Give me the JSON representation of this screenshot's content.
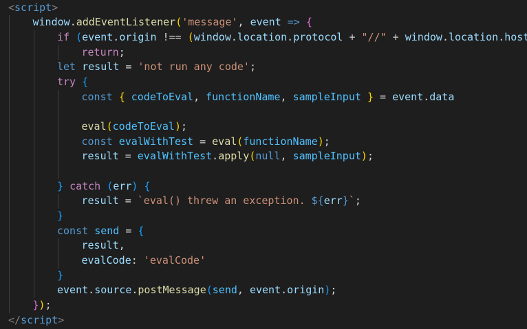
{
  "lines": [
    {
      "indent": 0,
      "tokens": [
        {
          "t": "<",
          "c": "t-tag"
        },
        {
          "t": "script",
          "c": "t-tagname"
        },
        {
          "t": ">",
          "c": "t-tag"
        }
      ]
    },
    {
      "indent": 1,
      "tokens": [
        {
          "t": "window",
          "c": "t-var"
        },
        {
          "t": ".",
          "c": "t-punc"
        },
        {
          "t": "addEventListener",
          "c": "t-fn"
        },
        {
          "t": "(",
          "c": "t-paren"
        },
        {
          "t": "'message'",
          "c": "t-string"
        },
        {
          "t": ", ",
          "c": "t-punc"
        },
        {
          "t": "event",
          "c": "t-var"
        },
        {
          "t": " ",
          "c": "t-punc"
        },
        {
          "t": "=>",
          "c": "t-keyword"
        },
        {
          "t": " ",
          "c": "t-punc"
        },
        {
          "t": "{",
          "c": "t-paren2"
        }
      ]
    },
    {
      "indent": 2,
      "tokens": [
        {
          "t": "if",
          "c": "t-control"
        },
        {
          "t": " ",
          "c": "t-punc"
        },
        {
          "t": "(",
          "c": "t-paren3"
        },
        {
          "t": "event",
          "c": "t-var"
        },
        {
          "t": ".",
          "c": "t-punc"
        },
        {
          "t": "origin",
          "c": "t-var"
        },
        {
          "t": " !== ",
          "c": "t-punc"
        },
        {
          "t": "(",
          "c": "t-paren"
        },
        {
          "t": "window",
          "c": "t-var"
        },
        {
          "t": ".",
          "c": "t-punc"
        },
        {
          "t": "location",
          "c": "t-var"
        },
        {
          "t": ".",
          "c": "t-punc"
        },
        {
          "t": "protocol",
          "c": "t-var"
        },
        {
          "t": " + ",
          "c": "t-punc"
        },
        {
          "t": "\"//\"",
          "c": "t-string"
        },
        {
          "t": " + ",
          "c": "t-punc"
        },
        {
          "t": "window",
          "c": "t-var"
        },
        {
          "t": ".",
          "c": "t-punc"
        },
        {
          "t": "location",
          "c": "t-var"
        },
        {
          "t": ".",
          "c": "t-punc"
        },
        {
          "t": "host",
          "c": "t-var"
        },
        {
          "t": ")",
          "c": "t-paren"
        },
        {
          "t": ")",
          "c": "t-paren3"
        }
      ]
    },
    {
      "indent": 3,
      "tokens": [
        {
          "t": "return",
          "c": "t-control"
        },
        {
          "t": ";",
          "c": "t-punc"
        }
      ]
    },
    {
      "indent": 2,
      "tokens": [
        {
          "t": "let",
          "c": "t-keyword"
        },
        {
          "t": " ",
          "c": "t-punc"
        },
        {
          "t": "result",
          "c": "t-var"
        },
        {
          "t": " = ",
          "c": "t-punc"
        },
        {
          "t": "'not run any code'",
          "c": "t-string"
        },
        {
          "t": ";",
          "c": "t-punc"
        }
      ]
    },
    {
      "indent": 2,
      "tokens": [
        {
          "t": "try",
          "c": "t-control"
        },
        {
          "t": " ",
          "c": "t-punc"
        },
        {
          "t": "{",
          "c": "t-paren3"
        }
      ]
    },
    {
      "indent": 3,
      "tokens": [
        {
          "t": "const",
          "c": "t-keyword"
        },
        {
          "t": " ",
          "c": "t-punc"
        },
        {
          "t": "{",
          "c": "t-paren"
        },
        {
          "t": " ",
          "c": "t-punc"
        },
        {
          "t": "codeToEval",
          "c": "t-const"
        },
        {
          "t": ", ",
          "c": "t-punc"
        },
        {
          "t": "functionName",
          "c": "t-const"
        },
        {
          "t": ", ",
          "c": "t-punc"
        },
        {
          "t": "sampleInput",
          "c": "t-const"
        },
        {
          "t": " ",
          "c": "t-punc"
        },
        {
          "t": "}",
          "c": "t-paren"
        },
        {
          "t": " = ",
          "c": "t-punc"
        },
        {
          "t": "event",
          "c": "t-var"
        },
        {
          "t": ".",
          "c": "t-punc"
        },
        {
          "t": "data",
          "c": "t-var"
        }
      ]
    },
    {
      "indent": 3,
      "tokens": []
    },
    {
      "indent": 3,
      "tokens": [
        {
          "t": "eval",
          "c": "t-fn"
        },
        {
          "t": "(",
          "c": "t-paren"
        },
        {
          "t": "codeToEval",
          "c": "t-const"
        },
        {
          "t": ")",
          "c": "t-paren"
        },
        {
          "t": ";",
          "c": "t-punc"
        }
      ]
    },
    {
      "indent": 3,
      "tokens": [
        {
          "t": "const",
          "c": "t-keyword"
        },
        {
          "t": " ",
          "c": "t-punc"
        },
        {
          "t": "evalWithTest",
          "c": "t-const"
        },
        {
          "t": " = ",
          "c": "t-punc"
        },
        {
          "t": "eval",
          "c": "t-fn"
        },
        {
          "t": "(",
          "c": "t-paren"
        },
        {
          "t": "functionName",
          "c": "t-const"
        },
        {
          "t": ")",
          "c": "t-paren"
        },
        {
          "t": ";",
          "c": "t-punc"
        }
      ]
    },
    {
      "indent": 3,
      "tokens": [
        {
          "t": "result",
          "c": "t-var"
        },
        {
          "t": " = ",
          "c": "t-punc"
        },
        {
          "t": "evalWithTest",
          "c": "t-const"
        },
        {
          "t": ".",
          "c": "t-punc"
        },
        {
          "t": "apply",
          "c": "t-fn"
        },
        {
          "t": "(",
          "c": "t-paren"
        },
        {
          "t": "null",
          "c": "t-keyword"
        },
        {
          "t": ", ",
          "c": "t-punc"
        },
        {
          "t": "sampleInput",
          "c": "t-const"
        },
        {
          "t": ")",
          "c": "t-paren"
        },
        {
          "t": ";",
          "c": "t-punc"
        }
      ]
    },
    {
      "indent": 3,
      "tokens": []
    },
    {
      "indent": 2,
      "tokens": [
        {
          "t": "}",
          "c": "t-paren3"
        },
        {
          "t": " ",
          "c": "t-punc"
        },
        {
          "t": "catch",
          "c": "t-control"
        },
        {
          "t": " ",
          "c": "t-punc"
        },
        {
          "t": "(",
          "c": "t-paren3"
        },
        {
          "t": "err",
          "c": "t-var"
        },
        {
          "t": ")",
          "c": "t-paren3"
        },
        {
          "t": " ",
          "c": "t-punc"
        },
        {
          "t": "{",
          "c": "t-paren3"
        }
      ]
    },
    {
      "indent": 3,
      "tokens": [
        {
          "t": "result",
          "c": "t-var"
        },
        {
          "t": " = ",
          "c": "t-punc"
        },
        {
          "t": "`eval() threw an exception. ",
          "c": "t-string"
        },
        {
          "t": "${",
          "c": "t-template"
        },
        {
          "t": "err",
          "c": "t-var"
        },
        {
          "t": "}",
          "c": "t-template"
        },
        {
          "t": "`",
          "c": "t-string"
        },
        {
          "t": ";",
          "c": "t-punc"
        }
      ]
    },
    {
      "indent": 2,
      "tokens": [
        {
          "t": "}",
          "c": "t-paren3"
        }
      ]
    },
    {
      "indent": 2,
      "tokens": [
        {
          "t": "const",
          "c": "t-keyword"
        },
        {
          "t": " ",
          "c": "t-punc"
        },
        {
          "t": "send",
          "c": "t-const"
        },
        {
          "t": " = ",
          "c": "t-punc"
        },
        {
          "t": "{",
          "c": "t-paren3"
        }
      ]
    },
    {
      "indent": 3,
      "tokens": [
        {
          "t": "result",
          "c": "t-var"
        },
        {
          "t": ",",
          "c": "t-punc"
        }
      ]
    },
    {
      "indent": 3,
      "tokens": [
        {
          "t": "evalCode",
          "c": "t-var"
        },
        {
          "t": ": ",
          "c": "t-punc"
        },
        {
          "t": "'evalCode'",
          "c": "t-string"
        }
      ]
    },
    {
      "indent": 2,
      "tokens": [
        {
          "t": "}",
          "c": "t-paren3"
        }
      ]
    },
    {
      "indent": 2,
      "tokens": [
        {
          "t": "event",
          "c": "t-var"
        },
        {
          "t": ".",
          "c": "t-punc"
        },
        {
          "t": "source",
          "c": "t-var"
        },
        {
          "t": ".",
          "c": "t-punc"
        },
        {
          "t": "postMessage",
          "c": "t-fn"
        },
        {
          "t": "(",
          "c": "t-paren3"
        },
        {
          "t": "send",
          "c": "t-const"
        },
        {
          "t": ", ",
          "c": "t-punc"
        },
        {
          "t": "event",
          "c": "t-var"
        },
        {
          "t": ".",
          "c": "t-punc"
        },
        {
          "t": "origin",
          "c": "t-var"
        },
        {
          "t": ")",
          "c": "t-paren3"
        },
        {
          "t": ";",
          "c": "t-punc"
        }
      ]
    },
    {
      "indent": 1,
      "tokens": [
        {
          "t": "}",
          "c": "t-paren2"
        },
        {
          "t": ")",
          "c": "t-paren"
        },
        {
          "t": ";",
          "c": "t-punc"
        }
      ]
    },
    {
      "indent": 0,
      "tokens": [
        {
          "t": "</",
          "c": "t-tag"
        },
        {
          "t": "script",
          "c": "t-tagname"
        },
        {
          "t": ">",
          "c": "t-tag"
        }
      ]
    }
  ],
  "colors": {
    "background": "#1e1e1e",
    "indent_guide": "#404040"
  }
}
